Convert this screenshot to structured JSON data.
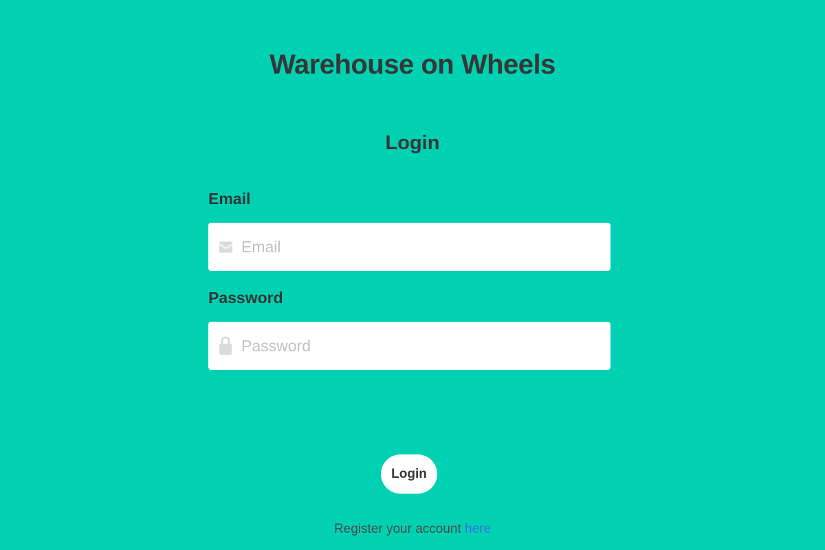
{
  "app": {
    "title": "Warehouse on Wheels"
  },
  "login_form": {
    "title": "Login",
    "email": {
      "label": "Email",
      "placeholder": "Email",
      "value": "",
      "icon": "envelope-icon"
    },
    "password": {
      "label": "Password",
      "placeholder": "Password",
      "value": "",
      "icon": "lock-icon"
    },
    "submit_label": "Login"
  },
  "register": {
    "text": "Register your account ",
    "link_label": "here"
  },
  "colors": {
    "background": "#00d1b2",
    "text": "#363636",
    "link": "#3273dc",
    "input_background": "#ffffff",
    "icon": "#dbdbdb"
  }
}
